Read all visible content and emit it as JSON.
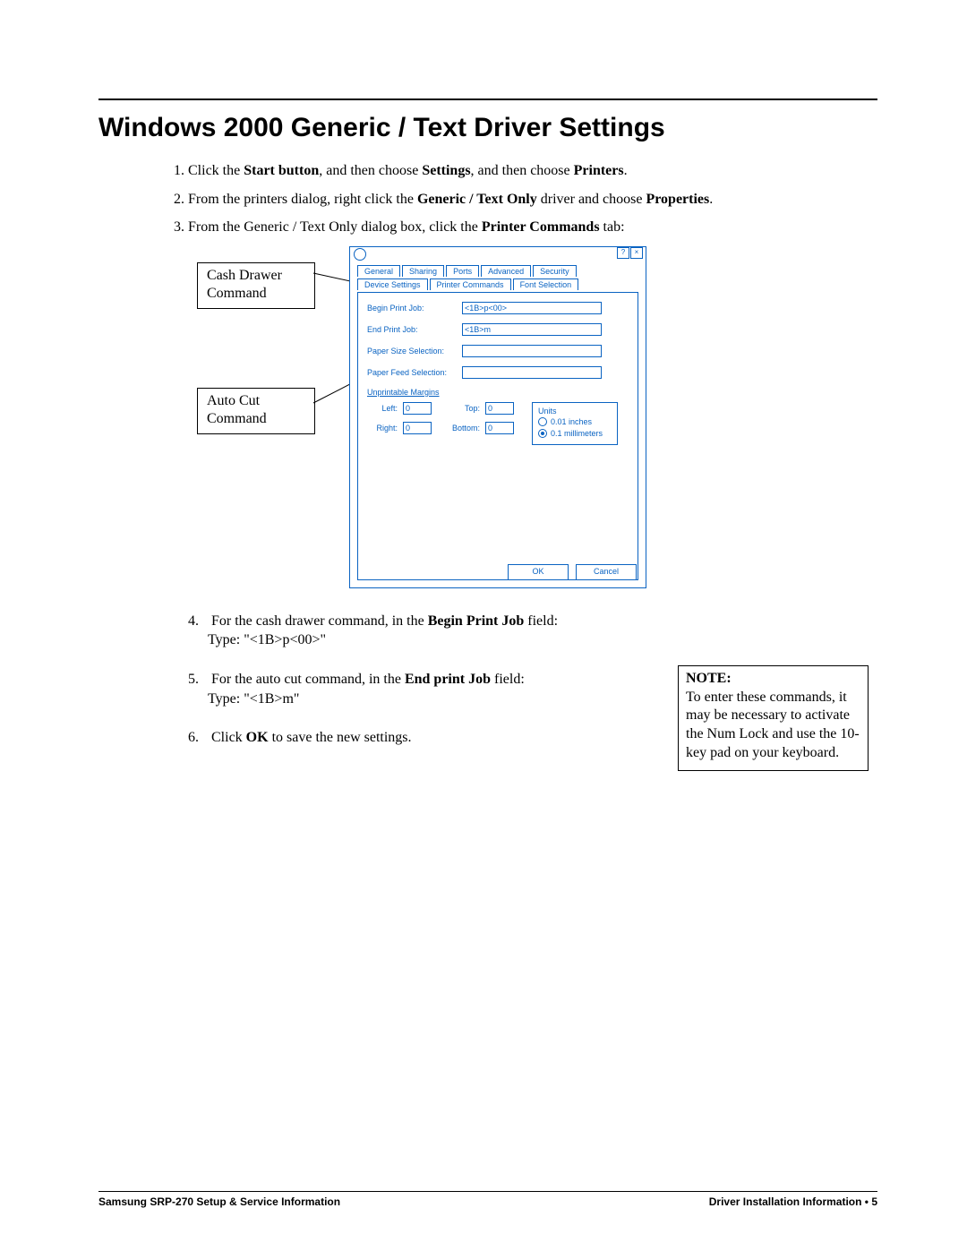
{
  "heading": "Windows 2000 Generic / Text Driver Settings",
  "steps_top": {
    "s1_pre": "Click the ",
    "s1_b1": "Start button",
    "s1_mid1": ", and then choose ",
    "s1_b2": "Settings",
    "s1_mid2": ", and then choose ",
    "s1_b3": "Printers",
    "s1_end": ".",
    "s2_pre": "From the printers dialog, right click the ",
    "s2_b1": "Generic / Text Only",
    "s2_mid": " driver and choose ",
    "s2_b2": "Properties",
    "s2_end": ".",
    "s3_pre": "From the Generic / Text Only dialog box, click the ",
    "s3_b1": "Printer Commands",
    "s3_end": " tab:"
  },
  "callouts": {
    "cash": "Cash Drawer Command",
    "autocut": "Auto Cut Command"
  },
  "dialog": {
    "titlebar": {
      "help": "?",
      "close": "×"
    },
    "tabs_row1": [
      "General",
      "Sharing",
      "Ports",
      "Advanced",
      "Security"
    ],
    "tabs_row2": [
      "Device Settings",
      "Printer Commands",
      "Font Selection"
    ],
    "labels": {
      "begin": "Begin Print Job:",
      "end": "End Print Job:",
      "psize": "Paper Size Selection:",
      "pfeed": "Paper Feed Selection:",
      "marg_title": "Unprintable Margins",
      "left": "Left:",
      "right": "Right:",
      "top": "Top:",
      "bottom": "Bottom:",
      "units": "Units",
      "unit1": "0.01 inches",
      "unit2": "0.1 millimeters"
    },
    "values": {
      "begin": "<1B>p<00>",
      "end": "<1B>m",
      "left": "0",
      "right": "0",
      "top": "0",
      "bottom": "0"
    },
    "buttons": {
      "ok": "OK",
      "cancel": "Cancel"
    }
  },
  "steps_bottom": {
    "s4_num": "4.",
    "s4_pre": "For the cash drawer command, in the ",
    "s4_b": "Begin Print Job",
    "s4_mid": " field:",
    "s4_line2": "Type:  \"<1B>p<00>\"",
    "s5_num": "5.",
    "s5_pre": "For the auto cut command, in the ",
    "s5_b": "End print Job",
    "s5_mid": " field:",
    "s5_line2": "Type:  \"<1B>m\"",
    "s6_num": "6.",
    "s6_pre": "Click ",
    "s6_b": "OK",
    "s6_end": " to save the new settings."
  },
  "note": {
    "title": "NOTE:",
    "body": "To enter these commands, it may be necessary to activate the Num Lock and use the 10-key pad on your keyboard."
  },
  "footer": {
    "left": "Samsung SRP-270 Setup & Service Information",
    "right": "Driver Installation Information  •  5"
  }
}
